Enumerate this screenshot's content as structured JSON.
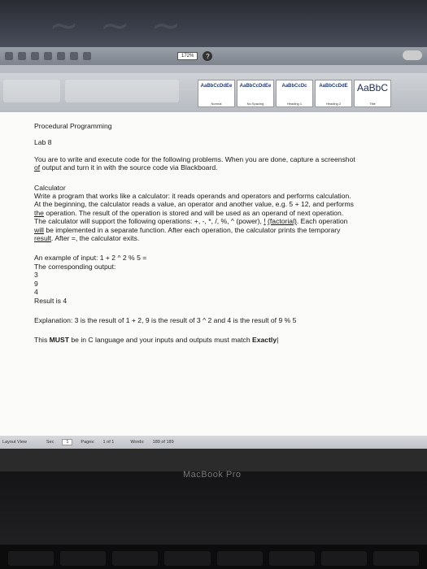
{
  "toolbar": {
    "zoom": "172%"
  },
  "styles": [
    {
      "sample": "AaBbCcDdEe",
      "name": "Normal"
    },
    {
      "sample": "AaBbCcDdEe",
      "name": "No Spacing"
    },
    {
      "sample": "AaBbCcDc",
      "name": "Heading 1"
    },
    {
      "sample": "AaBbCcDdE",
      "name": "Heading 2"
    },
    {
      "sample": "AaBbC",
      "name": "Title"
    }
  ],
  "document": {
    "heading": "Procedural Programming",
    "lab": "Lab 8",
    "p1a": "You are to write and execute code for the following problems. When you are done, capture a screenshot",
    "p1b_u": "of",
    "p1b": " output and turn it in with the source code via Blackboard.",
    "calc_title": "Calculator",
    "calc1": "Write a program that works like a calculator: it reads operands and operators and performs calculation.",
    "calc2": "At the beginning, the calculator reads a value, an operator and another value, e.g. 5 + 12, and performs",
    "calc3_u": "the",
    "calc3": " operation. The result of the operation is stored and will be used as an operand of next operation.",
    "calc4a": "The calculator will support the following operations: +, -, *, /, %, ^ (power), ",
    "calc4_u1": "!",
    "calc4_sp": " ",
    "calc4_u2": "(factorial)",
    "calc4b": ". Each operation",
    "calc5_u": "will",
    "calc5": " be implemented in a separate function. After each operation, the calculator prints the temporary",
    "calc6_u": "result",
    "calc6": ". After =, the calculator exits.",
    "ex1": "An example of input: 1 + 2 ^ 2 % 5 =",
    "ex2": "The corresponding output:",
    "out1": "3",
    "out2": "9",
    "out3": "4",
    "result": "Result is 4",
    "explanation": "Explanation: 3 is the result of 1 + 2, 9 is the result of 3 ^ 2 and 4 is the result of 9 % 5",
    "must_a": "This ",
    "must_b": "MUST",
    "must_c": " be in C language and your inputs and outputs must match ",
    "must_d": "Exactly"
  },
  "status": {
    "view": "Layout View",
    "sec_label": "Sec",
    "sec_val": "1",
    "pages_label": "Pages:",
    "pages_val": "1 of 1",
    "words_label": "Words:",
    "words_val": "189 of 189"
  },
  "device": {
    "label": "MacBook Pro"
  }
}
